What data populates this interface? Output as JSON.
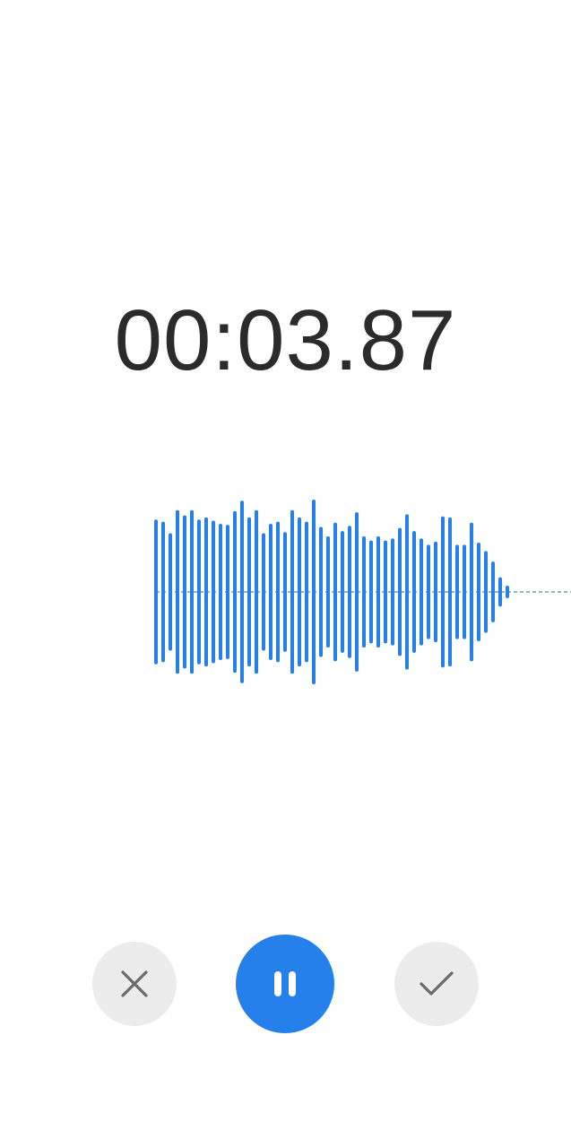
{
  "recorder": {
    "elapsed_time": "00:03.87",
    "state": "recording"
  },
  "colors": {
    "accent": "#2680eb",
    "timer_text": "#2b2b2b",
    "secondary_button_bg": "#ececec",
    "secondary_icon": "#6b6b6b",
    "primary_icon": "#ffffff",
    "baseline": "#2d6d9a"
  },
  "waveform": {
    "amplitude_levels": [
      0.69,
      0.67,
      0.56,
      0.78,
      0.73,
      0.78,
      0.69,
      0.71,
      0.68,
      0.65,
      0.64,
      0.77,
      0.87,
      0.71,
      0.78,
      0.56,
      0.65,
      0.67,
      0.57,
      0.78,
      0.71,
      0.67,
      0.88,
      0.62,
      0.53,
      0.66,
      0.58,
      0.63,
      0.76,
      0.53,
      0.49,
      0.53,
      0.49,
      0.51,
      0.61,
      0.74,
      0.58,
      0.51,
      0.45,
      0.48,
      0.72,
      0.71,
      0.45,
      0.45,
      0.66,
      0.47,
      0.39,
      0.29,
      0.14,
      0.06
    ]
  },
  "controls": {
    "cancel_icon": "close-icon",
    "pause_icon": "pause-icon",
    "confirm_icon": "checkmark-icon"
  }
}
